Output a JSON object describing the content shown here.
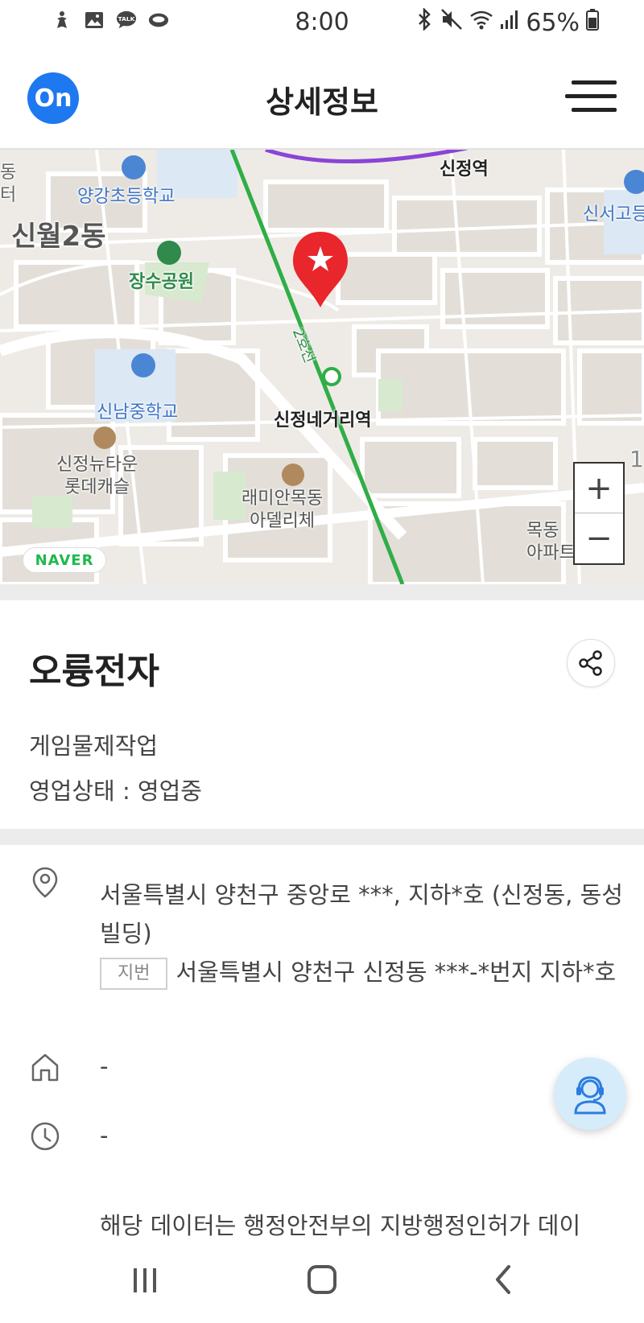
{
  "status_bar": {
    "time": "8:00",
    "battery": "65%",
    "left_icons": [
      "accessibility-icon",
      "image-icon",
      "talk-icon",
      "chat-icon"
    ],
    "right_icons": [
      "bluetooth-icon",
      "mute-icon",
      "wifi-icon",
      "signal-icon",
      "battery-icon"
    ],
    "talk_text": "TALK"
  },
  "header": {
    "logo_text": "On",
    "title": "상세정보",
    "brand_color": "#1e78f0"
  },
  "map": {
    "labels": {
      "dong_left_1": "동",
      "dong_left_2": "터",
      "school_1": "양강초등학교",
      "station_top": "신정역",
      "sinseo": "신서고등",
      "sinwol": "신월2동",
      "park": "장수공원",
      "line2": "2호선",
      "school_2": "신남중학교",
      "station_main": "신정네거리역",
      "apt_1a": "신정뉴타운",
      "apt_1b": "롯데캐슬",
      "apt_2a": "래미안목동",
      "apt_2b": "아델리체",
      "apt_3a": "목동",
      "apt_3b": "아파트",
      "edge_1": "1"
    },
    "provider": "NAVER",
    "zoom_in": "+",
    "zoom_out": "−",
    "marker_color": "#e8262c",
    "line2_color": "#2fae46",
    "purple_line_color": "#8a45d6"
  },
  "business": {
    "name": "오륭전자",
    "category": "게임물제작업",
    "status": "영업상태 : 영업중"
  },
  "details": {
    "road_address": "서울특별시 양천구 중앙로 ***, 지하*호 (신정동, 동성빌딩)",
    "jibun_label": "지번",
    "jibun_address": "서울특별시 양천구 신정동 ***-*번지 지하*호",
    "homepage": "-",
    "hours": "-",
    "notice": "해당 데이터는 행정안전부의 지방행정인허가 데이"
  }
}
